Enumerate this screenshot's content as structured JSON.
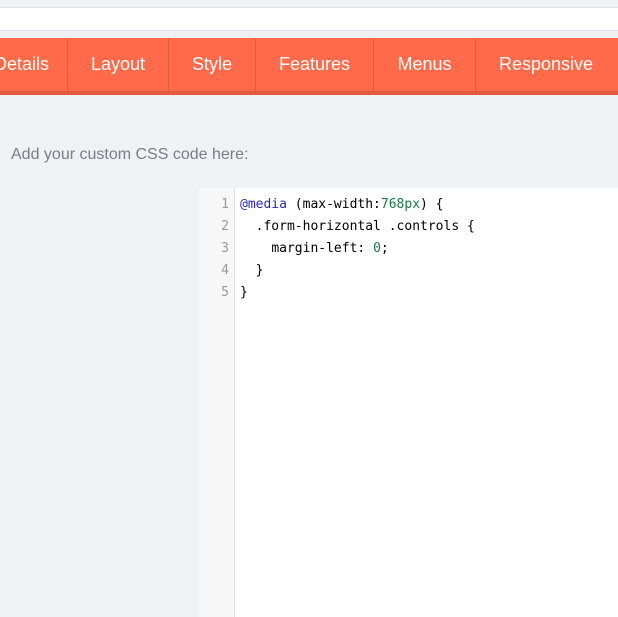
{
  "tabs": [
    {
      "label": "Details"
    },
    {
      "label": "Layout"
    },
    {
      "label": "Style"
    },
    {
      "label": "Features"
    },
    {
      "label": "Menus"
    },
    {
      "label": "Responsive"
    }
  ],
  "instructions": "Add your custom CSS code here:",
  "editor": {
    "line_numbers": [
      "1",
      "2",
      "3",
      "4",
      "5"
    ],
    "lines": [
      {
        "indent": "",
        "parts": [
          {
            "t": "@media",
            "c": "kw"
          },
          {
            "t": " (max-width:",
            "c": ""
          },
          {
            "t": "768px",
            "c": "num"
          },
          {
            "t": ") {",
            "c": ""
          }
        ]
      },
      {
        "indent": "  ",
        "parts": [
          {
            "t": ".form-horizontal .controls {",
            "c": ""
          }
        ]
      },
      {
        "indent": "    ",
        "parts": [
          {
            "t": "margin-left: ",
            "c": ""
          },
          {
            "t": "0",
            "c": "num"
          },
          {
            "t": ";",
            "c": ""
          }
        ]
      },
      {
        "indent": "  ",
        "parts": [
          {
            "t": "}",
            "c": ""
          }
        ]
      },
      {
        "indent": "",
        "parts": [
          {
            "t": "}",
            "c": ""
          }
        ]
      }
    ]
  },
  "colors": {
    "tab_bar": "#ff6b4a",
    "keyword": "#2a2ab5",
    "number": "#1a7a4a"
  }
}
